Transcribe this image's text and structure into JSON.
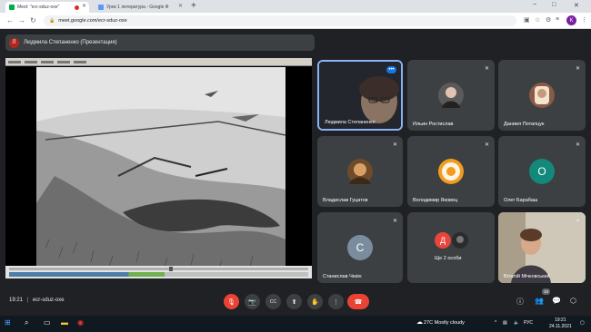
{
  "browser": {
    "tabs": [
      {
        "label": "Meet: \"ecr-sduz-oxe\"",
        "favicon_color": "#00ac47",
        "active": true,
        "recording": true
      },
      {
        "label": "Урок 1 литература - Google Ф",
        "favicon_color": "#5e97f6",
        "active": false
      }
    ],
    "new_tab": "+",
    "window_controls": {
      "minimize": "−",
      "maximize": "□",
      "close": "✕"
    },
    "url": "meet.google.com/ecr-sduz-oxe",
    "profile_initial": "К"
  },
  "meet": {
    "presenter_label": "Людмила Степаненко (Презентация)",
    "presenter_initial": "Л",
    "participants": [
      {
        "name": "Людмила Степаненко",
        "type": "video",
        "speaking": true
      },
      {
        "name": "Ильин Ростислав",
        "type": "photo",
        "avatar_color": "#5a5a5a"
      },
      {
        "name": "Даниил Потапцук",
        "type": "photo",
        "avatar_color": "#8a5a44"
      },
      {
        "name": "Владислав Гуцатов",
        "type": "photo",
        "avatar_color": "#6e4b2a"
      },
      {
        "name": "Володимир Яковец",
        "type": "photo",
        "avatar_color": "#f29c1f"
      },
      {
        "name": "Олег Барабаш",
        "type": "initial",
        "initial": "О",
        "avatar_color": "#12897b"
      },
      {
        "name": "Станислав Чизін",
        "type": "initial",
        "initial": "С",
        "avatar_color": "#7a8d9e"
      },
      {
        "name": "Ще 2 особи",
        "type": "group",
        "initial": "Д",
        "avatar_color": "#e8453c"
      },
      {
        "name": "Віталій Мічковський",
        "type": "video"
      }
    ],
    "time": "19:21",
    "separator": "|",
    "meeting_code": "ecr-sduz-oxe",
    "participants_count": "10",
    "controls": {
      "mic": "🎙",
      "camera": "📷",
      "captions": "CC",
      "present": "⬆",
      "raise_hand": "✋",
      "more": "⋮",
      "end_call": "☎"
    }
  },
  "taskbar": {
    "weather": "27C  Mostly cloudy",
    "lang": "РУС",
    "time": "19:21",
    "date": "24.11.2021"
  },
  "colors": {
    "meet_bg": "#202124",
    "tile_bg": "#3c4043",
    "accent_blue": "#8ab4f8",
    "red": "#ea4335"
  }
}
